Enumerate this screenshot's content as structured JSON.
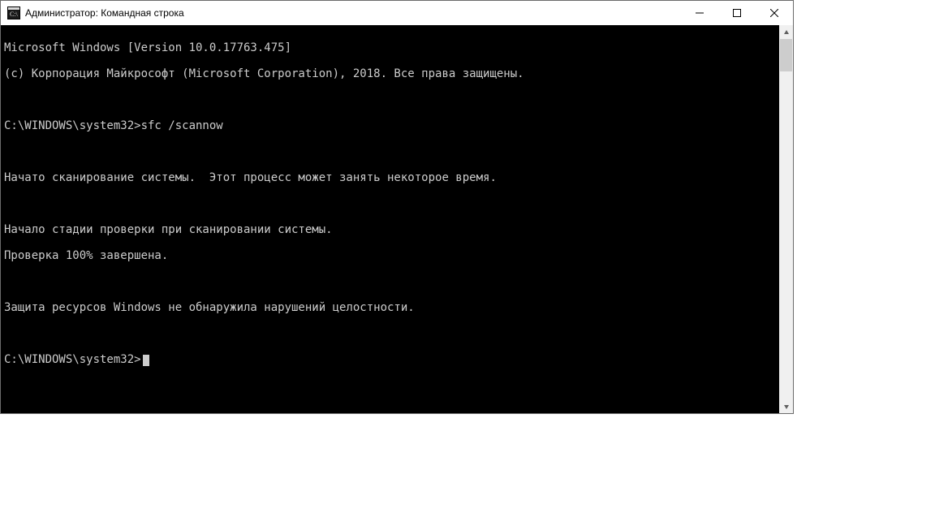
{
  "window": {
    "title": "Администратор: Командная строка"
  },
  "terminal": {
    "line_version": "Microsoft Windows [Version 10.0.17763.475]",
    "line_copyright": "(c) Корпорация Майкрософт (Microsoft Corporation), 2018. Все права защищены.",
    "prompt1_path": "C:\\WINDOWS\\system32>",
    "prompt1_cmd": "sfc /scannow",
    "line_scan_started": "Начато сканирование системы.  Этот процесс может занять некоторое время.",
    "line_stage_begin": "Начало стадии проверки при сканировании системы.",
    "line_progress": "Проверка 100% завершена.",
    "line_result": "Защита ресурсов Windows не обнаружила нарушений целостности.",
    "prompt2_path": "C:\\WINDOWS\\system32>"
  }
}
